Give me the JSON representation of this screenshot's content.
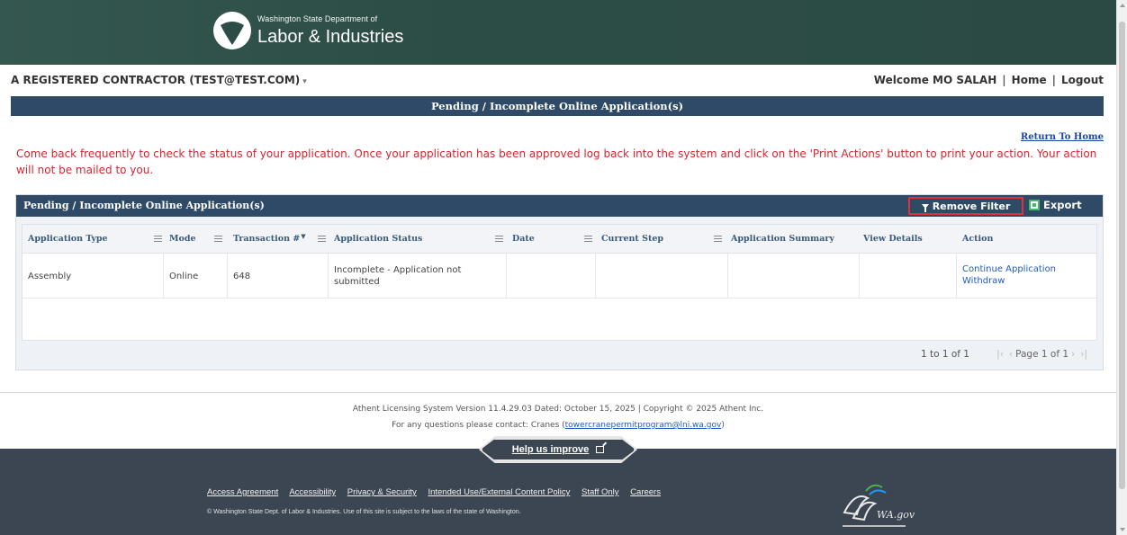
{
  "header": {
    "agency_small": "Washington State Department of",
    "agency_big": "Labor & Industries"
  },
  "userbar": {
    "account": "A REGISTERED CONTRACTOR  (TEST@TEST.COM)",
    "welcome": "Welcome MO SALAH",
    "home": "Home",
    "logout": "Logout"
  },
  "page_title": "Pending / Incomplete Online Application(s)",
  "return_link": "Return To Home",
  "notice": "Come back frequently to check the status of your application. Once your application has been approved log back into the system and click on the 'Print Actions' button to print your action. Your action will not be mailed to you.",
  "panel": {
    "title": "Pending / Incomplete Online Application(s)",
    "remove_filter": "Remove Filter",
    "export": "Export",
    "columns": [
      "Application Type",
      "Mode",
      "Transaction #",
      "Application Status",
      "Date",
      "Current Step",
      "Application Summary",
      "View Details",
      "Action"
    ],
    "rows": [
      {
        "application_type": "Assembly",
        "mode": "Online",
        "transaction": "648",
        "status": "Incomplete - Application not submitted",
        "date": "",
        "current_step": "",
        "summary": "",
        "view_details": "",
        "action_continue": "Continue Application",
        "action_withdraw": "Withdraw"
      }
    ],
    "pager_count": "1 to 1 of 1",
    "pager_page": "Page 1 of 1"
  },
  "footer": {
    "version": "Athent Licensing System Version 11.4.29.03 Dated: October 15, 2025 | Copyright © 2025 Athent Inc.",
    "contact_prefix": "For any questions please contact: Cranes (",
    "contact_email": "towercranepermitprogram@lni.wa.gov",
    "contact_suffix": ")",
    "help_button": "Help us improve",
    "links": [
      "Access Agreement",
      "Accessibility",
      "Privacy & Security",
      "Intended Use/External Content Policy",
      "Staff Only",
      "Careers"
    ],
    "legal": "© Washington State Dept. of Labor & Industries. Use of this site is subject to the laws of the state of Washington.",
    "wa_gov": "WA.gov"
  },
  "colors": {
    "header_bg": "#2c4d46",
    "title_bar": "#2e4a66",
    "notice_red": "#d9232e",
    "link_blue": "#1f5bc4",
    "footer_bg": "#3b4652",
    "highlight_red": "#e03040"
  }
}
